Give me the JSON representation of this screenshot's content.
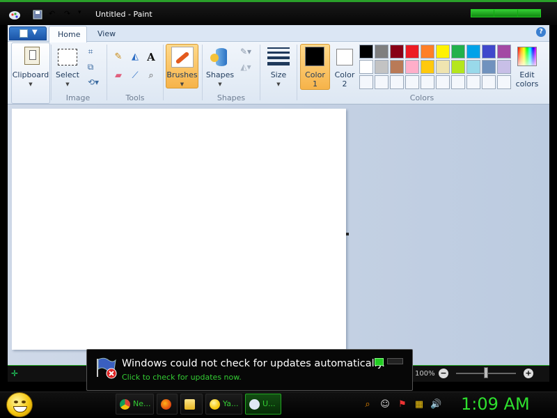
{
  "window": {
    "title": "Untitled - Paint"
  },
  "ribbon": {
    "tabs": [
      {
        "label": "Home"
      },
      {
        "label": "View"
      }
    ],
    "help_icon": "?",
    "groups": {
      "clipboard": {
        "button_label": "Clipboard"
      },
      "image": {
        "label": "Image",
        "select_label": "Select"
      },
      "tools": {
        "label": "Tools",
        "text_tool": "A"
      },
      "brushes": {
        "label": "Brushes"
      },
      "shapes": {
        "label": "Shapes",
        "button_label": "Shapes"
      },
      "size": {
        "label": "Size"
      },
      "colors": {
        "label": "Colors",
        "color1_label_line1": "Color",
        "color1_label_line2": "1",
        "color2_label_line1": "Color",
        "color2_label_line2": "2",
        "color1": "#000000",
        "color2": "#ffffff",
        "edit_label_line1": "Edit",
        "edit_label_line2": "colors",
        "palette_row1": [
          "#000000",
          "#7f7f7f",
          "#880015",
          "#ed1c24",
          "#ff7f27",
          "#fff200",
          "#22b14c",
          "#00a2e8",
          "#3f48cc",
          "#a349a4"
        ],
        "palette_row2": [
          "#ffffff",
          "#c3c3c3",
          "#b97a57",
          "#ffaec9",
          "#ffc90e",
          "#efe4b0",
          "#b5e61d",
          "#99d9ea",
          "#7092be",
          "#c8bfe7"
        ],
        "palette_row3": [
          "#f4f7fc",
          "#f4f7fc",
          "#f4f7fc",
          "#f4f7fc",
          "#f4f7fc",
          "#f4f7fc",
          "#f4f7fc",
          "#f4f7fc",
          "#f4f7fc",
          "#f4f7fc"
        ]
      }
    }
  },
  "status": {
    "zoom": "100%"
  },
  "notification": {
    "title": "Windows could not check for updates automatically.",
    "link": "Click to check for updates now."
  },
  "taskbar": {
    "buttons": [
      {
        "label": "Ne..."
      },
      {
        "label": ""
      },
      {
        "label": ""
      },
      {
        "label": "Ya..."
      },
      {
        "label": "U..."
      }
    ],
    "clock": "1:09 AM"
  }
}
